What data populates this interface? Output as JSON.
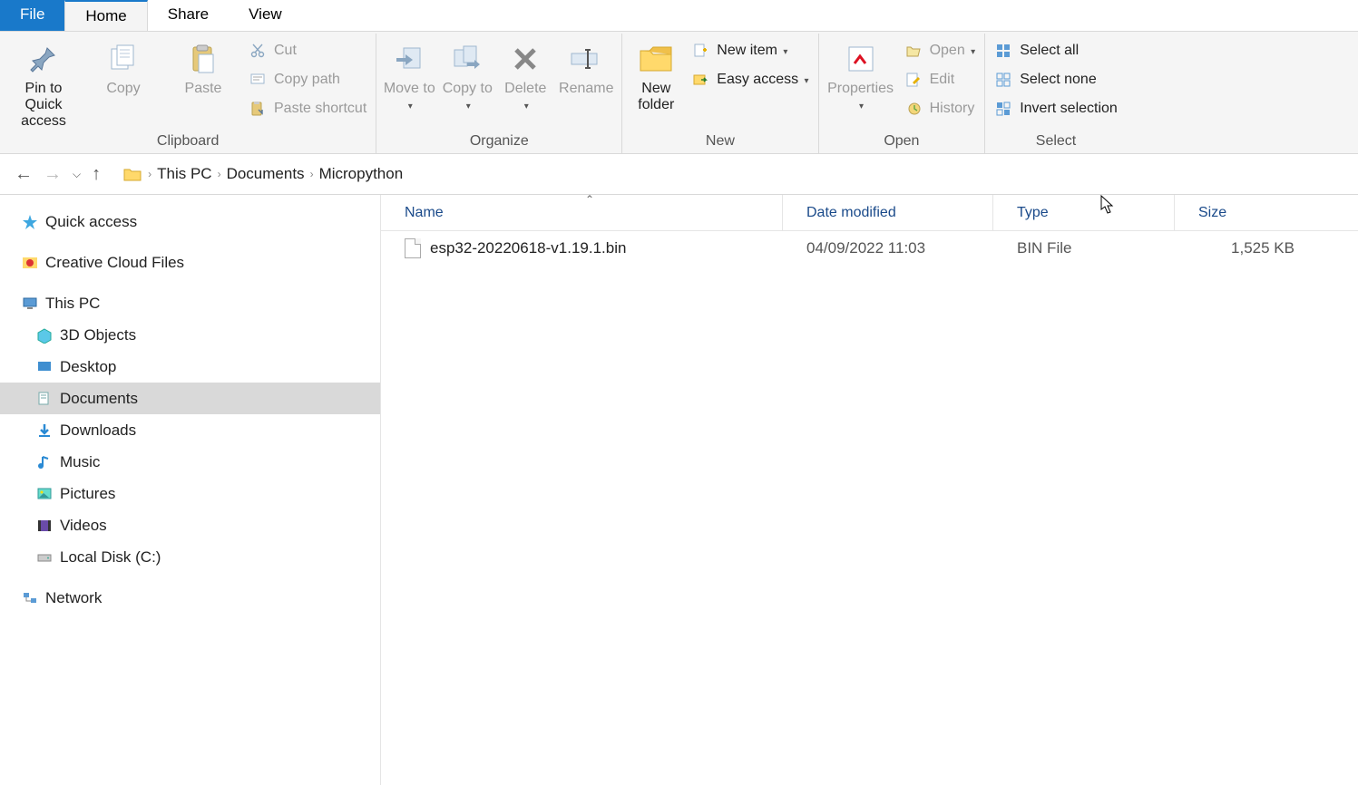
{
  "tabs": {
    "file": "File",
    "home": "Home",
    "share": "Share",
    "view": "View"
  },
  "ribbon": {
    "clipboard": {
      "label": "Clipboard",
      "pin": "Pin to Quick access",
      "copy": "Copy",
      "paste": "Paste",
      "cut": "Cut",
      "copypath": "Copy path",
      "pasteshortcut": "Paste shortcut"
    },
    "organize": {
      "label": "Organize",
      "moveto": "Move to",
      "copyto": "Copy to",
      "delete": "Delete",
      "rename": "Rename"
    },
    "new": {
      "label": "New",
      "newfolder": "New folder",
      "newitem": "New item",
      "easyaccess": "Easy access"
    },
    "open": {
      "label": "Open",
      "properties": "Properties",
      "open": "Open",
      "edit": "Edit",
      "history": "History"
    },
    "select": {
      "label": "Select",
      "selectall": "Select all",
      "selectnone": "Select none",
      "invert": "Invert selection"
    }
  },
  "breadcrumb": {
    "thispc": "This PC",
    "documents": "Documents",
    "current": "Micropython"
  },
  "tree": {
    "quickaccess": "Quick access",
    "creative": "Creative Cloud Files",
    "thispc": "This PC",
    "threed": "3D Objects",
    "desktop": "Desktop",
    "documents": "Documents",
    "downloads": "Downloads",
    "music": "Music",
    "pictures": "Pictures",
    "videos": "Videos",
    "localdisk": "Local Disk (C:)",
    "network": "Network"
  },
  "columns": {
    "name": "Name",
    "date": "Date modified",
    "type": "Type",
    "size": "Size"
  },
  "files": [
    {
      "name": "esp32-20220618-v1.19.1.bin",
      "date": "04/09/2022 11:03",
      "type": "BIN File",
      "size": "1,525 KB"
    }
  ]
}
